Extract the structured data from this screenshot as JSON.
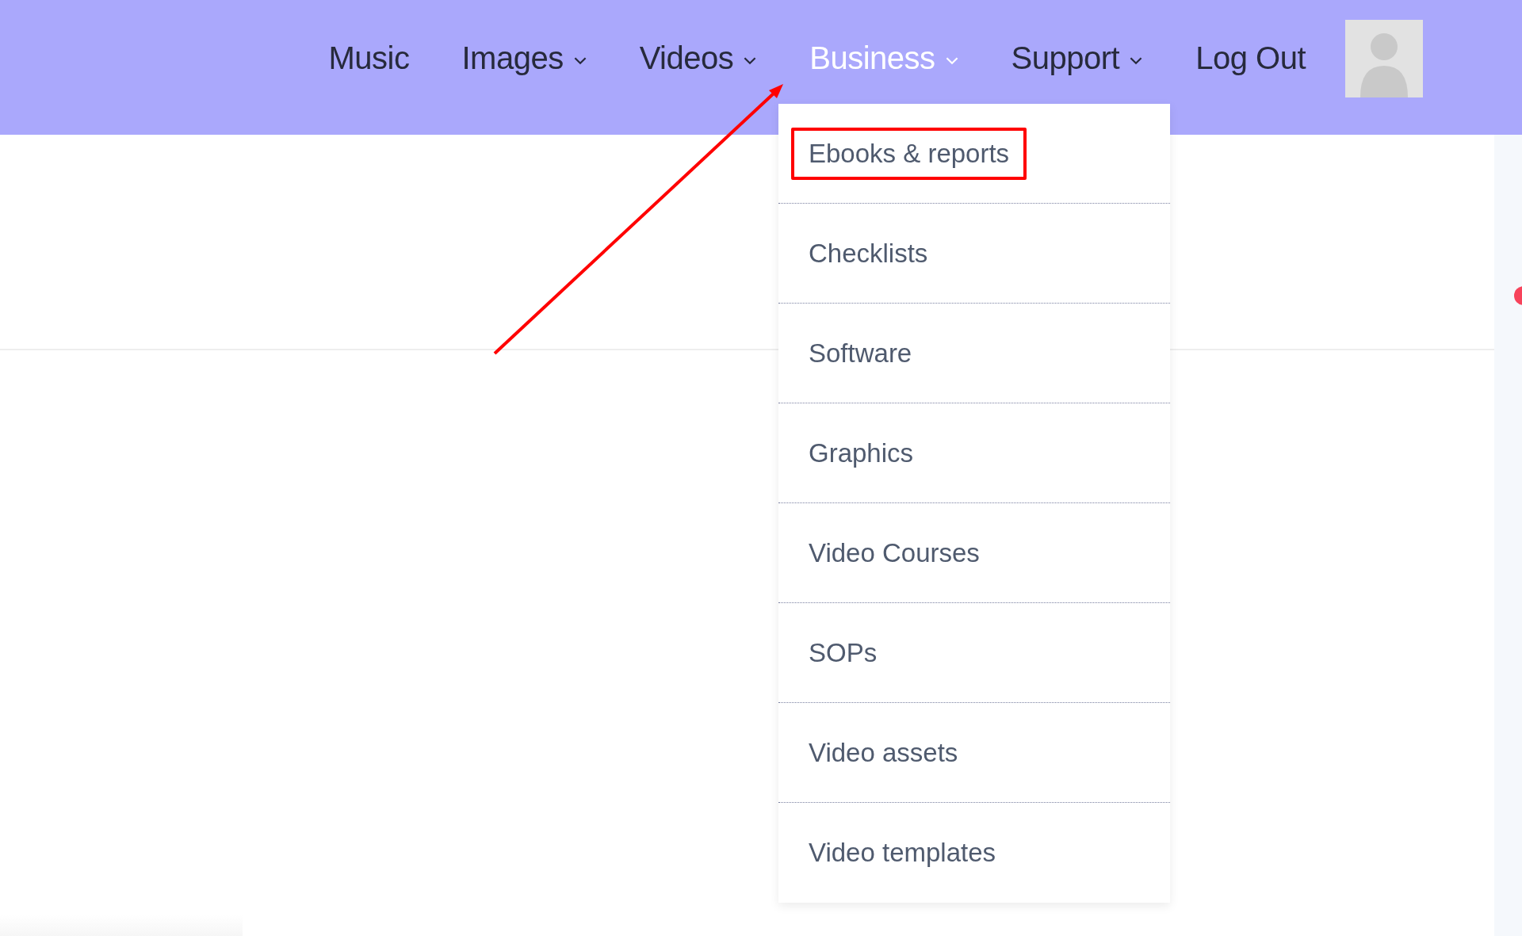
{
  "nav": [
    {
      "label": "Music",
      "has_dropdown": false,
      "selected": false
    },
    {
      "label": "Images",
      "has_dropdown": true,
      "selected": false
    },
    {
      "label": "Videos",
      "has_dropdown": true,
      "selected": false
    },
    {
      "label": "Business",
      "has_dropdown": true,
      "selected": true
    },
    {
      "label": "Support",
      "has_dropdown": true,
      "selected": false
    },
    {
      "label": "Log Out",
      "has_dropdown": false,
      "selected": false
    }
  ],
  "dropdown": [
    {
      "label": "Ebooks & reports",
      "outlined": true
    },
    {
      "label": "Checklists",
      "outlined": false
    },
    {
      "label": "Software",
      "outlined": false
    },
    {
      "label": "Graphics",
      "outlined": false
    },
    {
      "label": "Video Courses",
      "outlined": false
    },
    {
      "label": "SOPs",
      "outlined": false
    },
    {
      "label": "Video assets",
      "outlined": false
    },
    {
      "label": "Video templates",
      "outlined": false
    }
  ]
}
